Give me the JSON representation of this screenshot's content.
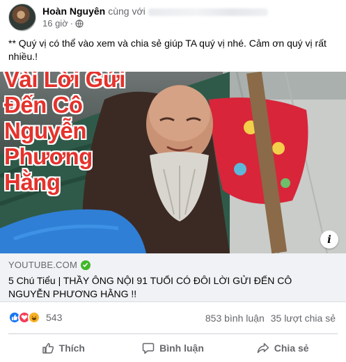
{
  "post": {
    "author": "Hoàn Nguyên",
    "with_text": "cùng với",
    "time": "16 giờ",
    "caption": "** Quý vị có thể vào xem và chia sẻ giúp TA quý vị nhé. Cảm ơn quý vị rất nhiều.!",
    "thumbnail_title": [
      "Vài Lời Gửi",
      "Đến Cô",
      "Nguyễn",
      "Phương",
      "Hằng"
    ],
    "info_glyph": "i",
    "privacy_icon": "globe-icon"
  },
  "link": {
    "domain": "YOUTUBE.COM",
    "title": "5 Chú Tiểu | THẦY ÔNG NỘI 91 TUỔI CÓ ĐÔI LỜI GỬI ĐẾN CÔ NGUYỄN PHƯƠNG HẰNG !!",
    "verified_icon": "check-circle-icon"
  },
  "stats": {
    "reactions": [
      "like-icon",
      "love-icon",
      "haha-icon"
    ],
    "reaction_count": "543",
    "comments": "853 bình luận",
    "shares": "35 lượt chia sẻ"
  },
  "actions": {
    "like": "Thích",
    "comment": "Bình luận",
    "share": "Chia sẻ"
  },
  "colors": {
    "facebook_blue": "#1877f2",
    "love_red": "#f33e58",
    "haha_yellow": "#f7b125",
    "thumbnail_text": "#e5322c",
    "verified_green": "#42b72a"
  }
}
